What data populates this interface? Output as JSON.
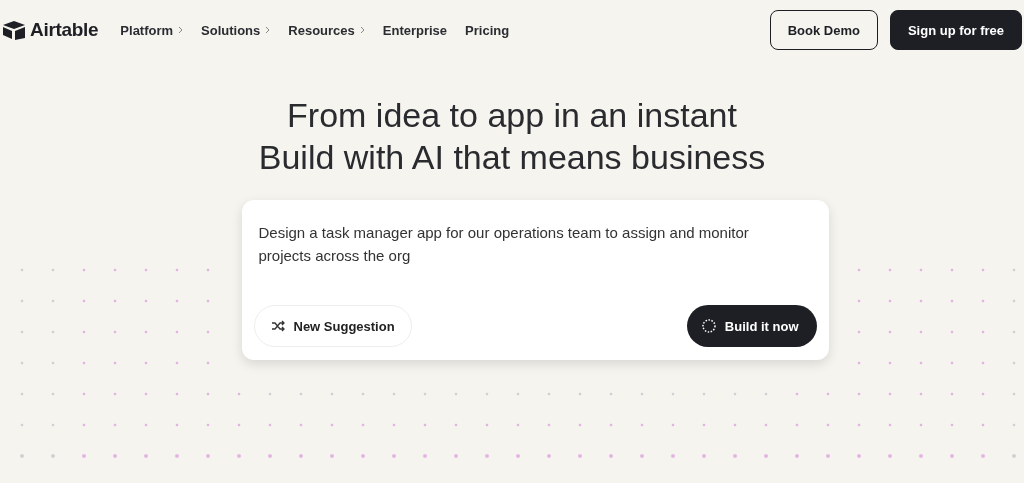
{
  "header": {
    "logo": "Airtable",
    "nav": [
      {
        "label": "Platform",
        "has_submenu": true
      },
      {
        "label": "Solutions",
        "has_submenu": true
      },
      {
        "label": "Resources",
        "has_submenu": true
      },
      {
        "label": "Enterprise",
        "has_submenu": false
      },
      {
        "label": "Pricing",
        "has_submenu": false
      }
    ],
    "buttons": [
      {
        "label": "Book Demo",
        "kind": "outline"
      },
      {
        "label": "Sign up for free",
        "kind": "filled"
      }
    ]
  },
  "hero": {
    "title_lines": [
      "From idea to app in an instant",
      "Build with AI that means business"
    ],
    "prompt": {
      "value": "Design a task manager app for our operations team to assign and monitor projects across the org",
      "suggestion_button": "New Suggestion",
      "build_button": "Build it now"
    }
  }
}
